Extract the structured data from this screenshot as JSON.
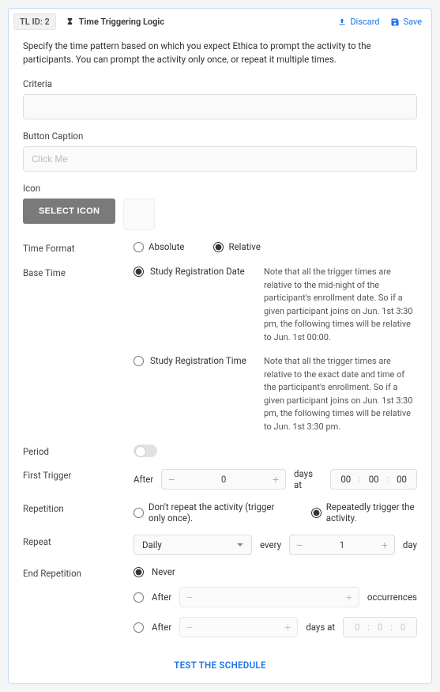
{
  "header": {
    "tl_id": "TL ID: 2",
    "title": "Time Triggering Logic",
    "discard": "Discard",
    "save": "Save"
  },
  "intro": "Specify the time pattern based on which you expect Ethica to prompt the activity to the participants. You can prompt the activity only once, or repeat it multiple times.",
  "criteria": {
    "label": "Criteria",
    "value": ""
  },
  "button_caption": {
    "label": "Button Caption",
    "placeholder": "Click Me",
    "value": ""
  },
  "icon": {
    "label": "Icon",
    "button": "SELECT ICON"
  },
  "time_format": {
    "label": "Time Format",
    "absolute": "Absolute",
    "relative": "Relative",
    "selected": "relative"
  },
  "base_time": {
    "label": "Base Time",
    "option_date": "Study Registration Date",
    "option_time": "Study Registration Time",
    "selected": "date",
    "note_date": "Note that all the trigger times are relative to the mid-night of the participant's enrollment date. So if a given participant joins on Jun. 1st 3:30 pm, the following times will be relative to Jun. 1st 00:00.",
    "note_time": "Note that all the trigger times are relative to the exact date and time of the participant's enrollment. So if a given participant joins on Jun. 1st 3:30 pm, the following times will be relative to Jun. 1st 3:30 pm."
  },
  "period": {
    "label": "Period",
    "enabled": false
  },
  "first_trigger": {
    "label": "First Trigger",
    "after": "After",
    "days": "0",
    "days_at": "days at",
    "hh": "00",
    "mm": "00",
    "ss": "00"
  },
  "repetition": {
    "label": "Repetition",
    "once": "Don't repeat the activity (trigger only once).",
    "repeat": "Repeatedly trigger the activity.",
    "selected": "repeat"
  },
  "repeat": {
    "label": "Repeat",
    "freq": "Daily",
    "every": "every",
    "interval": "1",
    "unit": "day"
  },
  "end": {
    "label": "End Repetition",
    "never": "Never",
    "after": "After",
    "occurrences_suffix": "occurrences",
    "days_at": "days at",
    "hh": "0",
    "mm": "0",
    "ss": "0",
    "selected": "never"
  },
  "footer": {
    "test": "TEST THE SCHEDULE"
  }
}
